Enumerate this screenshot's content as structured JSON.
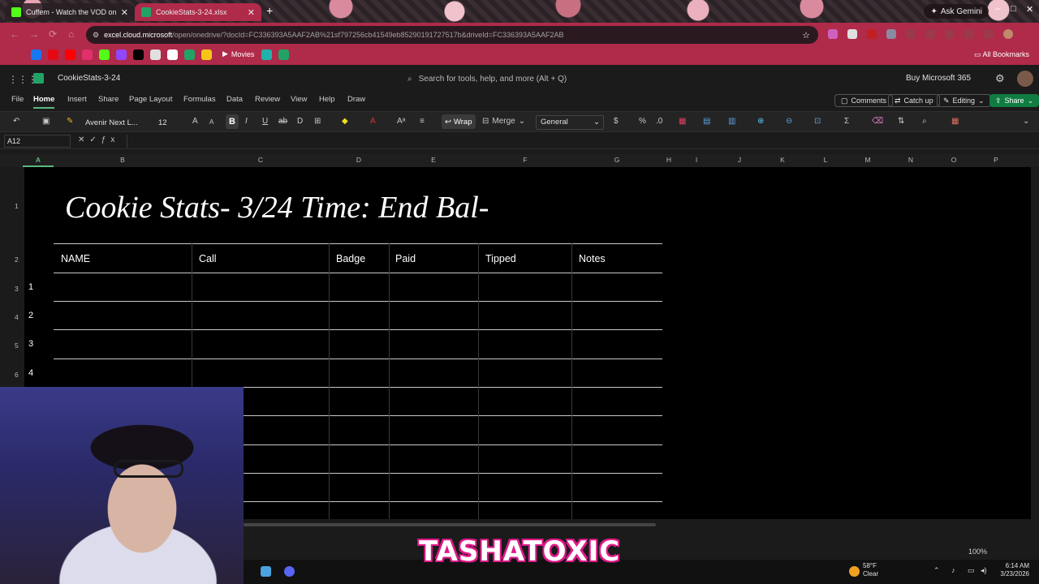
{
  "browser": {
    "tabs": [
      {
        "title": "Cuffem - Watch the VOD on K...",
        "color": "#53fc18"
      },
      {
        "title": "CookieStats-3-24.xlsx",
        "color": "#21a366"
      }
    ],
    "ask_gemini": "Ask Gemini",
    "url_host": "excel.cloud.microsoft",
    "url_path": "/open/onedrive/?docId=FC336393A5AAF2AB%21sf797256cb41549eb85290191727517b&driveId=FC336393A5AAF2AB",
    "bookmarks_movies": "Movies",
    "all_bookmarks": "All Bookmarks"
  },
  "excel": {
    "doc_name": "CookieStats-3-24",
    "search_placeholder": "Search for tools, help, and more (Alt + Q)",
    "buy": "Buy Microsoft 365",
    "ribbon_tabs": [
      "File",
      "Home",
      "Insert",
      "Share",
      "Page Layout",
      "Formulas",
      "Data",
      "Review",
      "View",
      "Help",
      "Draw"
    ],
    "comments": "Comments",
    "catch_up": "Catch up",
    "editing": "Editing",
    "share": "Share",
    "font_name": "Avenir Next L...",
    "font_size": "12",
    "wrap": "Wrap",
    "merge": "Merge",
    "number_format": "General",
    "name_box": "A12",
    "columns": [
      "A",
      "B",
      "C",
      "D",
      "E",
      "F",
      "G",
      "H",
      "I",
      "J",
      "K",
      "L",
      "M",
      "N",
      "O",
      "P"
    ],
    "row_numbers": [
      "1",
      "2",
      "3",
      "4",
      "5",
      "6"
    ],
    "zoom": "100%"
  },
  "sheet": {
    "title": "Cookie Stats- 3/24 Time: End Bal-",
    "headers": [
      "NAME",
      "Call",
      "Badge",
      "Paid",
      "Tipped",
      "Notes"
    ],
    "rows": [
      "1",
      "2",
      "3",
      "4"
    ]
  },
  "taskbar": {
    "weather_temp": "58°F",
    "weather_cond": "Clear",
    "time": "6:14 AM",
    "date": "3/23/2026"
  },
  "overlay": {
    "watermark": "TASHATOXIC"
  }
}
